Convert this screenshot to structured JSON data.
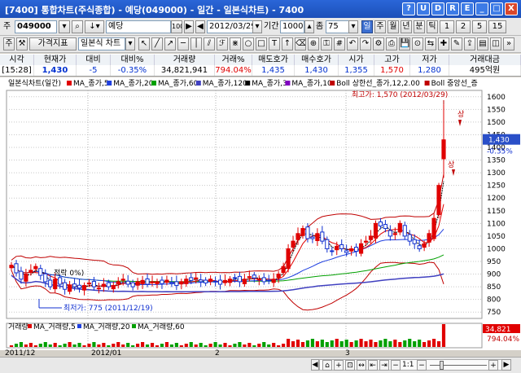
{
  "window": {
    "title": "[7400] 통합차트(주식종합) - 예당(049000) - 일간 - 일본식차트) - 7400",
    "buttons": [
      "?",
      "U",
      "D",
      "R",
      "E",
      "_",
      "□",
      "X"
    ]
  },
  "toolbar1": {
    "market_label": "주",
    "code": "049000",
    "name": "예당",
    "date": "2012/03/29",
    "period_label": "기간",
    "period_value": "1000",
    "unit_label": "좀",
    "unit_value": "75",
    "period_tabs": [
      "일",
      "주",
      "월",
      "년",
      "분",
      "틱",
      "1",
      "2",
      "5",
      "15"
    ],
    "active_tab": "일"
  },
  "toolbar2": {
    "prefix": "주",
    "indicator_button": "가격지표",
    "chart_type": "일본식 차트"
  },
  "quote": {
    "headers": [
      "시각",
      "현재가",
      "대비",
      "대비%",
      "거래량",
      "거래%",
      "매도호가",
      "매수호가",
      "시가",
      "고가",
      "저가",
      "거래대금"
    ],
    "values": [
      "[15:28]",
      "1,430",
      "-5",
      "-0.35%",
      "34,821,941",
      "794.04%",
      "1,435",
      "1,430",
      "1,355",
      "1,570",
      "1,280",
      "495억원"
    ]
  },
  "legend": {
    "price": "일본식차트(일간)",
    "items": [
      {
        "label": "MA_종가,5",
        "color": "#e00000"
      },
      {
        "label": "MA_종가,20",
        "color": "#2040e0"
      },
      {
        "label": "MA_종가,60",
        "color": "#00a000"
      },
      {
        "label": "MA_종가,120",
        "color": "#4040c0"
      },
      {
        "label": "MA_종가,3",
        "color": "#000000"
      },
      {
        "label": "MA_종가,10",
        "color": "#8000c0"
      },
      {
        "label": "Boll 상한선_종가,12,2.00",
        "color": "#c00000"
      },
      {
        "label": "Boll 중앙선_증",
        "color": "#c00000"
      }
    ]
  },
  "annotations": {
    "high": "최고가: 1,570 (2012/03/29)",
    "low": "최저가: 775 (2011/12/19)",
    "pct": "적락 0%)",
    "up1": "상",
    "up2": "상"
  },
  "price_axis": {
    "ticks": [
      "1600",
      "1550",
      "1500",
      "1450",
      "1400",
      "1350",
      "1300",
      "1250",
      "1200",
      "1150",
      "1100",
      "1050",
      "1000",
      "950",
      "900",
      "850",
      "800",
      "750"
    ],
    "current_price": "1,430",
    "current_pct": "-0.35%"
  },
  "volume": {
    "legend": [
      "거래량",
      "MA_거래량,5",
      "MA_거래량,20",
      "MA_거래량,60"
    ],
    "value": "34,821",
    "pct": "794.04%"
  },
  "x_axis": {
    "labels": [
      "2011/12",
      "2012/01",
      "2",
      "3"
    ]
  },
  "bottom": {
    "zoom_label": "1:1"
  },
  "colors": {
    "up": "#e00000",
    "down": "#1030d0",
    "grid": "#c8c8c8",
    "title_bar": "#2a66d8"
  }
}
